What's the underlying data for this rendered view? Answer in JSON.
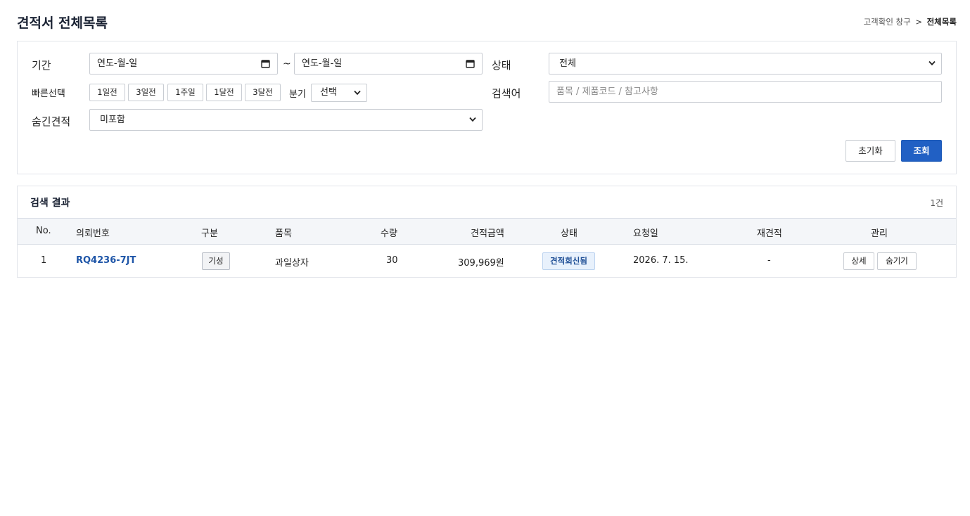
{
  "header": {
    "title": "견적서 전체목록",
    "breadcrumb": {
      "parent": "고객확인 창구",
      "separator": ">",
      "current": "전체목록"
    }
  },
  "filters": {
    "period_label": "기간",
    "date_from_placeholder": "연도-월-일",
    "date_to_placeholder": "연도-월-일",
    "range_separator": "~",
    "status_label": "상태",
    "status_value": "전체",
    "quick_label": "빠른선택",
    "quick_buttons": [
      "1일전",
      "3일전",
      "1주일",
      "1달전",
      "3달전"
    ],
    "quarter_label": "분기",
    "quarter_value": "선택",
    "keyword_label": "검색어",
    "keyword_placeholder": "품목 / 제품코드 / 참고사항",
    "hidden_label": "숨긴견적",
    "hidden_value": "미포함",
    "reset_label": "초기화",
    "search_label": "조회"
  },
  "results": {
    "title": "검색 결과",
    "count": "1건",
    "columns": [
      "No.",
      "의뢰번호",
      "구분",
      "품목",
      "수량",
      "견적금액",
      "상태",
      "요청일",
      "재견적",
      "관리"
    ],
    "rows": [
      {
        "no": "1",
        "request_no": "RQ4236-7JT",
        "type": "기성",
        "item": "과일상자",
        "qty": "30",
        "amount": "309,969원",
        "status": "견적회신됨",
        "requested": "2026. 7. 15.",
        "requote": "-",
        "actions": [
          "상세",
          "숨기기"
        ]
      }
    ]
  }
}
